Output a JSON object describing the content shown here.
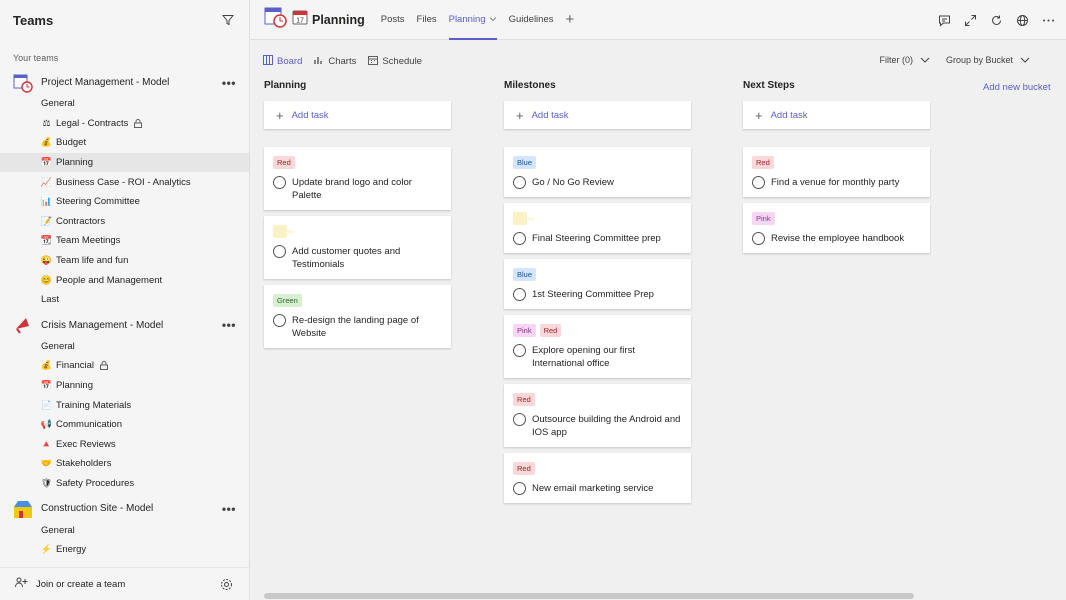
{
  "sidebar": {
    "title": "Teams",
    "your_teams": "Your teams",
    "teams": [
      {
        "name": "Project Management - Model",
        "icon": "calendar-clock-icon",
        "more": "•••",
        "channels": [
          {
            "name": "General",
            "emoji": ""
          },
          {
            "name": "Legal - Contracts",
            "emoji": "⚖",
            "locked": true
          },
          {
            "name": "Budget",
            "emoji": "💰"
          },
          {
            "name": "Planning",
            "emoji": "📅",
            "selected": true
          },
          {
            "name": "Business Case - ROI - Analytics",
            "emoji": "📈"
          },
          {
            "name": "Steering Committee",
            "emoji": "📊"
          },
          {
            "name": "Contractors",
            "emoji": "📝"
          },
          {
            "name": "Team Meetings",
            "emoji": "📆"
          },
          {
            "name": "Team life and fun",
            "emoji": "😜"
          },
          {
            "name": "People and Management",
            "emoji": "😊"
          },
          {
            "name": "Last",
            "emoji": ""
          }
        ]
      },
      {
        "name": "Crisis Management - Model",
        "icon": "megaphone-icon",
        "more": "•••",
        "channels": [
          {
            "name": "General",
            "emoji": ""
          },
          {
            "name": "Financial",
            "emoji": "💰",
            "locked": true
          },
          {
            "name": "Planning",
            "emoji": "📅"
          },
          {
            "name": "Training Materials",
            "emoji": "📄"
          },
          {
            "name": "Communication",
            "emoji": "📢"
          },
          {
            "name": "Exec Reviews",
            "emoji": "🔺"
          },
          {
            "name": "Stakeholders",
            "emoji": "🤝"
          },
          {
            "name": "Safety Procedures",
            "emoji": "🛡"
          }
        ]
      },
      {
        "name": "Construction Site - Model",
        "icon": "construction-icon",
        "more": "•••",
        "channels": [
          {
            "name": "General",
            "emoji": ""
          },
          {
            "name": "Energy",
            "emoji": "⚡"
          }
        ]
      }
    ],
    "footer": {
      "join_label": "Join or create a team"
    }
  },
  "topbar": {
    "channel_title": "Planning",
    "tabs": [
      "Posts",
      "Files",
      "Planning",
      "Guidelines"
    ],
    "active_tab": "Planning",
    "plus": "+"
  },
  "subbar": {
    "views": [
      "Board",
      "Charts",
      "Schedule"
    ],
    "active_view": "Board",
    "filter_label": "Filter (0)",
    "group_label": "Group by Bucket"
  },
  "board": {
    "add_task_label": "Add task",
    "add_bucket_label": "Add new bucket",
    "buckets": [
      {
        "title": "Planning",
        "tasks": [
          {
            "labels": [
              "Red"
            ],
            "title": "Update brand logo and color Palette"
          },
          {
            "labels": [
              "Yellow"
            ],
            "title": "Add customer quotes and Testimonials"
          },
          {
            "labels": [
              "Green"
            ],
            "title": "Re-design the landing page of Website"
          }
        ]
      },
      {
        "title": "Milestones",
        "tasks": [
          {
            "labels": [
              "Blue"
            ],
            "title": "Go / No Go Review"
          },
          {
            "labels": [
              "Yellow"
            ],
            "title": "Final Steering Committee prep"
          },
          {
            "labels": [
              "Blue"
            ],
            "title": "1st Steering Committee Prep"
          },
          {
            "labels": [
              "Pink",
              "Red"
            ],
            "title": "Explore opening our first International office"
          },
          {
            "labels": [
              "Red"
            ],
            "title": "Outsource building the Android and IOS app"
          },
          {
            "labels": [
              "Red"
            ],
            "title": "New email marketing service"
          }
        ]
      },
      {
        "title": "Next Steps",
        "tasks": [
          {
            "labels": [
              "Red"
            ],
            "title": "Find a venue for monthly party"
          },
          {
            "labels": [
              "Pink"
            ],
            "title": "Revise the employee handbook"
          }
        ]
      }
    ]
  }
}
